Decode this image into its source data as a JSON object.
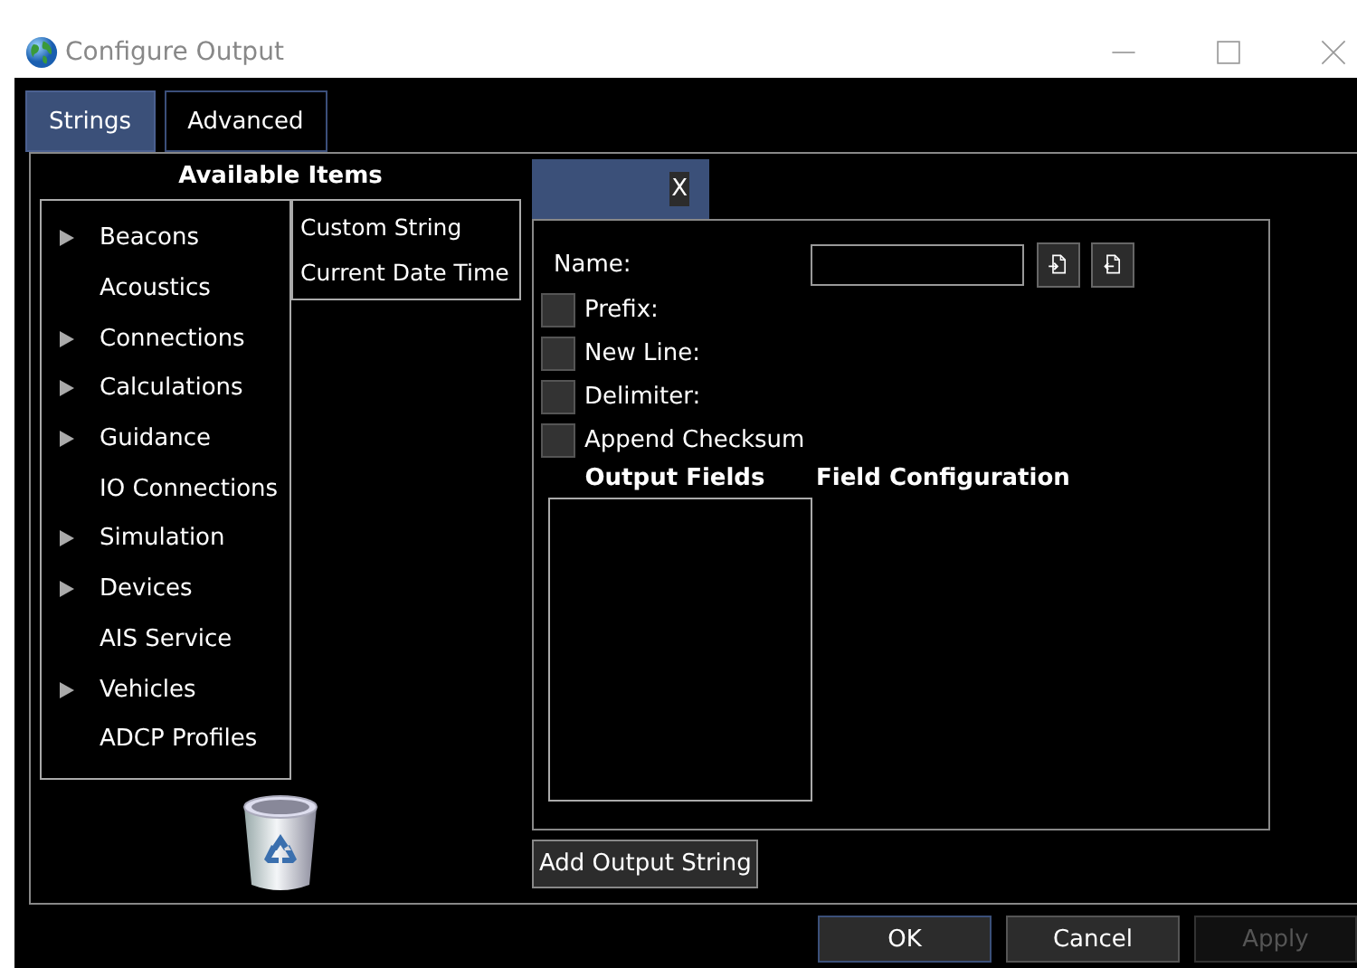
{
  "window": {
    "title": "Configure Output"
  },
  "tabs": [
    {
      "label": "Strings",
      "selected": true
    },
    {
      "label": "Advanced",
      "selected": false
    }
  ],
  "available_items": {
    "title": "Available Items",
    "tree": [
      {
        "label": "Beacons",
        "has_children": true
      },
      {
        "label": "Acoustics",
        "has_children": false
      },
      {
        "label": "Connections",
        "has_children": true
      },
      {
        "label": "Calculations",
        "has_children": true
      },
      {
        "label": "Guidance",
        "has_children": true
      },
      {
        "label": "IO Connections",
        "has_children": false
      },
      {
        "label": "Simulation",
        "has_children": true
      },
      {
        "label": "Devices",
        "has_children": true
      },
      {
        "label": "AIS Service",
        "has_children": false
      },
      {
        "label": "Vehicles",
        "has_children": true
      },
      {
        "label": "ADCP Profiles",
        "has_children": false
      }
    ],
    "items": [
      "Custom String",
      "Current Date Time"
    ]
  },
  "string_tabs": [
    {
      "close_label": "X",
      "selected": true
    }
  ],
  "string_config": {
    "name_label": "Name:",
    "options": [
      {
        "label": "Prefix:",
        "checked": false
      },
      {
        "label": "New Line:",
        "checked": false
      },
      {
        "label": "Delimiter:",
        "checked": false
      },
      {
        "label": "Append Checksum",
        "checked": false
      }
    ],
    "output_fields_title": "Output Fields",
    "field_configuration_title": "Field Configuration"
  },
  "add_button": "Add Output String",
  "buttons": [
    {
      "label": "OK",
      "disabled": false,
      "default": true
    },
    {
      "label": "Cancel",
      "disabled": false,
      "default": false
    },
    {
      "label": "Apply",
      "disabled": true,
      "default": false
    }
  ]
}
